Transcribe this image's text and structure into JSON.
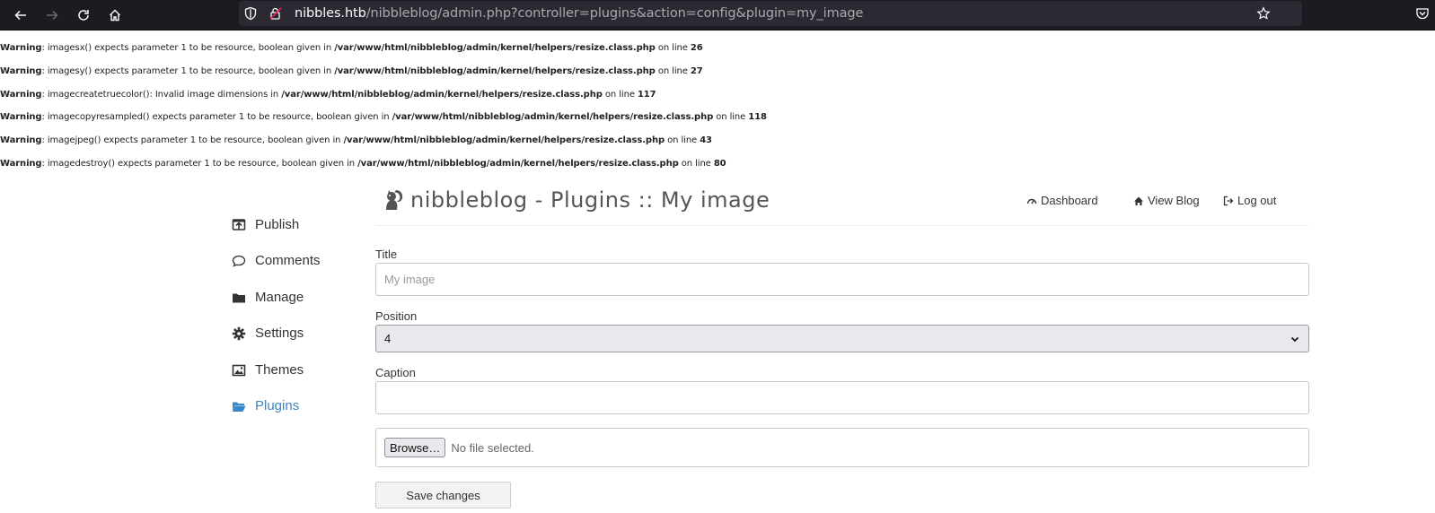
{
  "browser": {
    "url_host": "nibbles.htb",
    "url_path": "/nibbleblog/admin.php?controller=plugins&action=config&plugin=my_image"
  },
  "warnings": [
    {
      "label": "Warning",
      "msg": ": imagesx() expects parameter 1 to be resource, boolean given in ",
      "file": "/var/www/html/nibbleblog/admin/kernel/helpers/resize.class.php",
      "online": " on line ",
      "line": "26"
    },
    {
      "label": "Warning",
      "msg": ": imagesy() expects parameter 1 to be resource, boolean given in ",
      "file": "/var/www/html/nibbleblog/admin/kernel/helpers/resize.class.php",
      "online": " on line ",
      "line": "27"
    },
    {
      "label": "Warning",
      "msg": ": imagecreatetruecolor(): Invalid image dimensions in ",
      "file": "/var/www/html/nibbleblog/admin/kernel/helpers/resize.class.php",
      "online": " on line ",
      "line": "117"
    },
    {
      "label": "Warning",
      "msg": ": imagecopyresampled() expects parameter 1 to be resource, boolean given in ",
      "file": "/var/www/html/nibbleblog/admin/kernel/helpers/resize.class.php",
      "online": " on line ",
      "line": "118"
    },
    {
      "label": "Warning",
      "msg": ": imagejpeg() expects parameter 1 to be resource, boolean given in ",
      "file": "/var/www/html/nibbleblog/admin/kernel/helpers/resize.class.php",
      "online": " on line ",
      "line": "43"
    },
    {
      "label": "Warning",
      "msg": ": imagedestroy() expects parameter 1 to be resource, boolean given in ",
      "file": "/var/www/html/nibbleblog/admin/kernel/helpers/resize.class.php",
      "online": " on line ",
      "line": "80"
    }
  ],
  "header": {
    "title": "nibbleblog - Plugins :: My image",
    "nav": {
      "dashboard": "Dashboard",
      "view_blog": "View Blog",
      "logout": "Log out"
    }
  },
  "sidebar": {
    "items": [
      {
        "label": "Publish",
        "icon": "publish-icon"
      },
      {
        "label": "Comments",
        "icon": "comment-icon"
      },
      {
        "label": "Manage",
        "icon": "folder-icon"
      },
      {
        "label": "Settings",
        "icon": "gear-icon"
      },
      {
        "label": "Themes",
        "icon": "image-icon"
      },
      {
        "label": "Plugins",
        "icon": "folder-open-icon",
        "active": true
      }
    ]
  },
  "form": {
    "title_label": "Title",
    "title_placeholder": "My image",
    "title_value": "",
    "position_label": "Position",
    "position_value": "4",
    "caption_label": "Caption",
    "caption_value": "",
    "browse_label": "Browse…",
    "file_status": "No file selected.",
    "save_label": "Save changes"
  },
  "colors": {
    "accent": "#3a87c7",
    "chrome_bg": "#1c1b22",
    "urlbar_bg": "#2b2a33"
  }
}
